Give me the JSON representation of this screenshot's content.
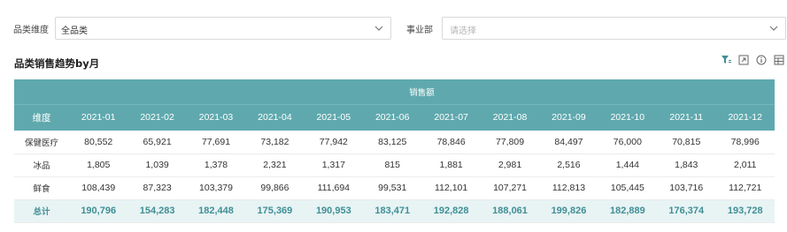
{
  "filters": {
    "category_label": "品类维度",
    "category_value": "全品类",
    "department_label": "事业部",
    "department_placeholder": "请选择"
  },
  "chart": {
    "title": "品类销售趋势by月",
    "toolbar_icons": [
      "filter-icon",
      "expand-icon",
      "info-icon",
      "table-view-icon"
    ]
  },
  "table": {
    "group_header": "销售额",
    "dimension_header": "维度",
    "months": [
      "2021-01",
      "2021-02",
      "2021-03",
      "2021-04",
      "2021-05",
      "2021-06",
      "2021-07",
      "2021-08",
      "2021-09",
      "2021-10",
      "2021-11",
      "2021-12"
    ],
    "rows": [
      {
        "name": "保健医疗",
        "values": [
          "80,552",
          "65,921",
          "77,691",
          "73,182",
          "77,942",
          "83,125",
          "78,846",
          "77,809",
          "84,497",
          "76,000",
          "70,815",
          "78,996"
        ]
      },
      {
        "name": "冰品",
        "values": [
          "1,805",
          "1,039",
          "1,378",
          "2,321",
          "1,317",
          "815",
          "1,881",
          "2,981",
          "2,516",
          "1,444",
          "1,843",
          "2,011"
        ]
      },
      {
        "name": "鲜食",
        "values": [
          "108,439",
          "87,323",
          "103,379",
          "99,866",
          "111,694",
          "99,531",
          "112,101",
          "107,271",
          "112,813",
          "105,445",
          "103,716",
          "112,721"
        ]
      }
    ],
    "total": {
      "name": "总计",
      "values": [
        "190,796",
        "154,283",
        "182,448",
        "175,369",
        "190,953",
        "183,471",
        "192,828",
        "188,061",
        "199,826",
        "182,889",
        "176,374",
        "193,728"
      ]
    }
  },
  "colors": {
    "header_bg": "#5fa9ae",
    "total_bg": "#e8f3f4",
    "total_text": "#3f8f95"
  }
}
